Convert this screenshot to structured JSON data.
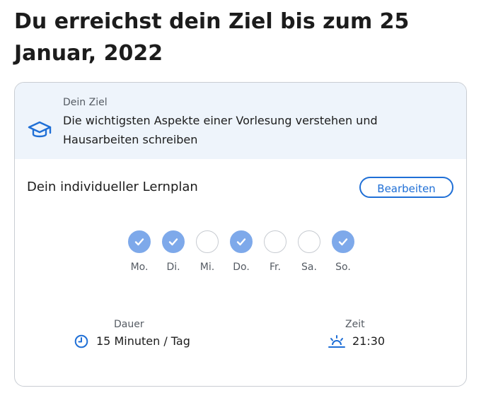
{
  "header": {
    "title": "Du erreichst dein Ziel bis zum 25 Januar, 2022"
  },
  "goal": {
    "label": "Dein Ziel",
    "text": "Die wichtigsten Aspekte einer Vorlesung verstehen und Hausarbeiten schreiben",
    "icon": "graduation-cap-icon"
  },
  "plan": {
    "title": "Dein individueller Lernplan",
    "edit_label": "Bearbeiten",
    "days": [
      {
        "label": "Mo.",
        "checked": true
      },
      {
        "label": "Di.",
        "checked": true
      },
      {
        "label": "Mi.",
        "checked": false
      },
      {
        "label": "Do.",
        "checked": true
      },
      {
        "label": "Fr.",
        "checked": false
      },
      {
        "label": "Sa.",
        "checked": false
      },
      {
        "label": "So.",
        "checked": true
      }
    ],
    "duration": {
      "label": "Dauer",
      "value": "15 Minuten / Tag",
      "icon": "clock-icon"
    },
    "time": {
      "label": "Zeit",
      "value": "21:30",
      "icon": "sunset-icon"
    }
  },
  "colors": {
    "accent": "#1f6fd6",
    "checked_day": "#7ea9ea",
    "goal_background": "#eef4fb",
    "card_border": "#c9cdd3"
  }
}
